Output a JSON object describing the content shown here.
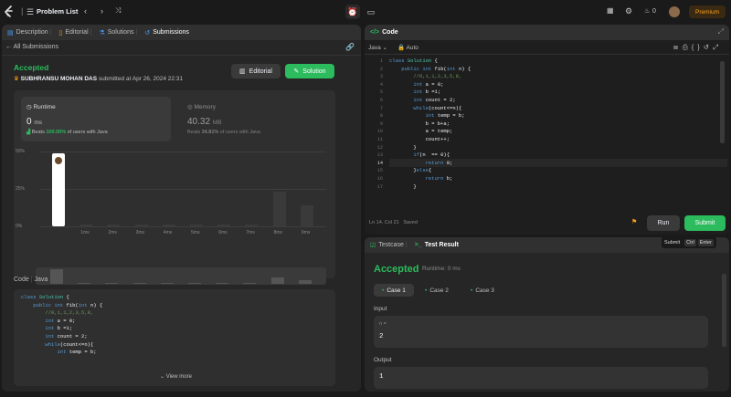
{
  "topbar": {
    "title": "Problem List",
    "streak": "0",
    "premium": "Premium"
  },
  "left": {
    "tabs": [
      {
        "label": "Description"
      },
      {
        "label": "Editorial"
      },
      {
        "label": "Solutions"
      },
      {
        "label": "Submissions"
      }
    ],
    "back_label": "All Submissions",
    "status": "Accepted",
    "user": "SUBHRANSU MOHAN DAS",
    "submitted": "submitted at Apr 26, 2024 22:31",
    "editorial_btn": "Editorial",
    "solution_btn": "Solution",
    "runtime_label": "Runtime",
    "runtime_value": "0",
    "runtime_unit": "ms",
    "runtime_beats_pre": "Beats",
    "runtime_beats_pct": "100.00%",
    "runtime_beats_post": "of users with Java",
    "memory_label": "Memory",
    "memory_value": "40.32",
    "memory_unit": "MB",
    "memory_beats_pre": "Beats",
    "memory_beats_pct": "34.81%",
    "memory_beats_post": "of users with Java",
    "code_label": "Code",
    "code_lang": "Java",
    "view_more": "View more",
    "code_lines": [
      "class Solution {",
      "    public int fib(int n) {",
      "        //0,1,1,2,3,5,8,",
      "        int a = 0;",
      "        int b =1;",
      "        int count = 2;",
      "        while(count<=n){",
      "            int temp = b;"
    ]
  },
  "chart_data": {
    "type": "bar",
    "ytick_labels": [
      "50%",
      "25%",
      "0%"
    ],
    "categories": [
      "",
      "1ms",
      "2ms",
      "3ms",
      "4ms",
      "5ms",
      "6ms",
      "7ms",
      "8ms",
      "9ms"
    ],
    "values": [
      49,
      0.8,
      0.8,
      0.8,
      0.8,
      0.8,
      0.8,
      0.8,
      23,
      14
    ],
    "ylim": [
      0,
      50
    ],
    "highlight_index": 0,
    "grid": true
  },
  "right": {
    "code_tab": "Code",
    "lang": "Java",
    "auto": "Auto",
    "line_numbers": [
      "1",
      "2",
      "3",
      "4",
      "5",
      "6",
      "7",
      "8",
      "9",
      "10",
      "11",
      "12",
      "13",
      "14",
      "15",
      "16",
      "17"
    ],
    "code_lines": [
      "class Solution {",
      "    public int fib(int n) {",
      "        //0,1,1,2,3,5,8,",
      "        int a = 0;",
      "        int b =1;",
      "        int count = 2;",
      "        while(count<=n){",
      "            int temp = b;",
      "            b = b+a;",
      "            a = temp;",
      "            count++;",
      "        }",
      "        if(n  == 0){",
      "            return 0;",
      "        }else{",
      "            return b;",
      "        }"
    ],
    "status": "Ln 14, Col 21",
    "saved": "Saved",
    "run": "Run",
    "submit": "Submit",
    "tip": [
      "Submit",
      "Ctrl",
      "Enter"
    ],
    "testcase_tab": "Testcase",
    "result_tab": "Test Result",
    "result_status": "Accepted",
    "result_runtime": "Runtime: 0 ms",
    "cases": [
      "Case 1",
      "Case 2",
      "Case 3"
    ],
    "input_label": "Input",
    "input_var": "n =",
    "input_value": "2",
    "output_label": "Output",
    "output_value": "1"
  },
  "colors": {
    "accent": "#2cbb5d",
    "brand": "#ffa116",
    "bg": "#1a1a1a",
    "panel": "#262626"
  }
}
